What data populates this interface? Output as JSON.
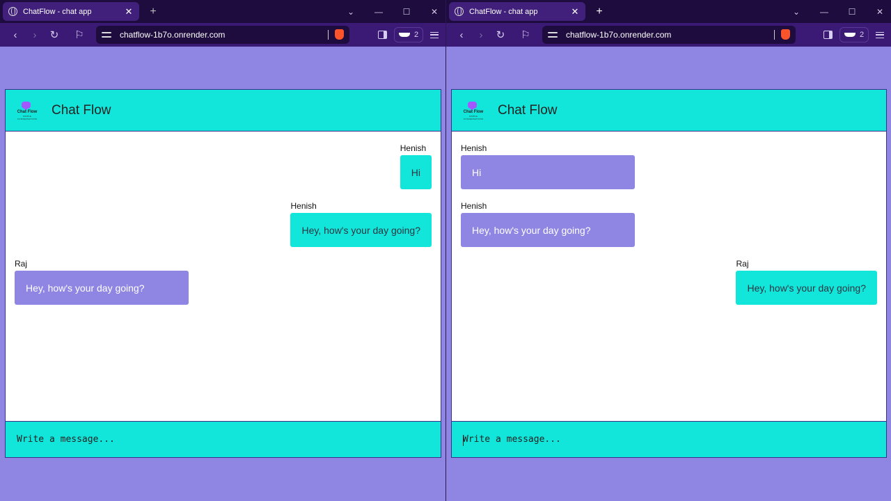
{
  "browser": {
    "tab_title": "ChatFlow - chat app",
    "url": "chatflow-1b7o.onrender.com",
    "vpn_count": "2"
  },
  "app": {
    "title": "Chat Flow",
    "logo_text": "Chat Flow",
    "logo_subtext": "SIMPLE CONVERSATIONS",
    "composer_placeholder": "Write a message..."
  },
  "colors": {
    "accent": "#12e6da",
    "incoming": "#8f86e3",
    "page_bg": "#8f86e3"
  },
  "left_window": {
    "messages": [
      {
        "sender": "Henish",
        "text": "Hi",
        "direction": "outgoing"
      },
      {
        "sender": "Henish",
        "text": "Hey, how's your day going?",
        "direction": "outgoing"
      },
      {
        "sender": "Raj",
        "text": "Hey, how's your day going?",
        "direction": "incoming"
      }
    ]
  },
  "right_window": {
    "messages": [
      {
        "sender": "Henish",
        "text": "Hi",
        "direction": "incoming"
      },
      {
        "sender": "Henish",
        "text": "Hey, how's your day going?",
        "direction": "incoming"
      },
      {
        "sender": "Raj",
        "text": "Hey, how's your day going?",
        "direction": "outgoing"
      }
    ]
  }
}
